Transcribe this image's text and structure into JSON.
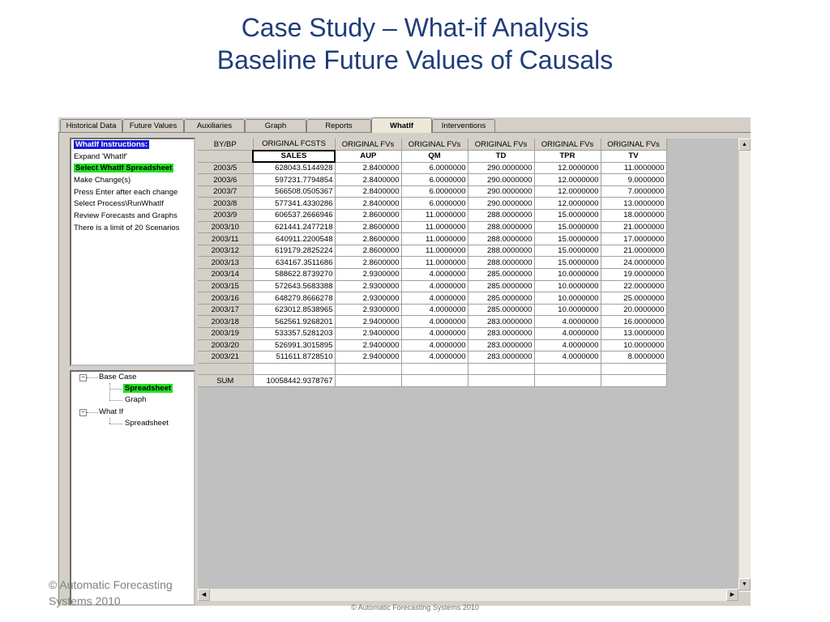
{
  "slide": {
    "title_line1": "Case Study – What-if Analysis",
    "title_line2": "Baseline Future Values of Causals",
    "footer_left": "© Automatic Forecasting Systems 2010",
    "footer_center": "© Automatic Forecasting Systems 2010"
  },
  "tabs": [
    {
      "label": "Historical Data"
    },
    {
      "label": "Future Values"
    },
    {
      "label": "Auxiliaries"
    },
    {
      "label": "Graph"
    },
    {
      "label": "Reports"
    },
    {
      "label": "WhatIf",
      "active": true
    },
    {
      "label": "Interventions"
    }
  ],
  "instructions": {
    "heading": "WhatIf Instructions:",
    "items": [
      "Expand 'WhatIf'",
      "Select WhatIf Spreadsheet",
      "Make Change(s)",
      "Press Enter after each change",
      "Select Process\\RunWhatIf",
      "Review Forecasts and Graphs",
      "There is a limit of 20 Scenarios"
    ]
  },
  "tree": {
    "base_case": "Base Case",
    "base_spreadsheet": "Spreadsheet",
    "base_graph": "Graph",
    "what_if": "What If",
    "whatif_spreadsheet": "Spreadsheet"
  },
  "grid": {
    "corner": "BY/BP",
    "header_row1": [
      "ORIGINAL FCSTS",
      "ORIGINAL FVs",
      "ORIGINAL FVs",
      "ORIGINAL FVs",
      "ORIGINAL FVs",
      "ORIGINAL FVs"
    ],
    "header_row2": [
      "SALES",
      "AUP",
      "QM",
      "TD",
      "TPR",
      "TV"
    ],
    "rows": [
      {
        "label": "2003/5",
        "values": [
          "628043.5144928",
          "2.8400000",
          "6.0000000",
          "290.0000000",
          "12.0000000",
          "11.0000000"
        ]
      },
      {
        "label": "2003/6",
        "values": [
          "597231.7794854",
          "2.8400000",
          "6.0000000",
          "290.0000000",
          "12.0000000",
          "9.0000000"
        ]
      },
      {
        "label": "2003/7",
        "values": [
          "566508.0505367",
          "2.8400000",
          "6.0000000",
          "290.0000000",
          "12.0000000",
          "7.0000000"
        ]
      },
      {
        "label": "2003/8",
        "values": [
          "577341.4330286",
          "2.8400000",
          "6.0000000",
          "290.0000000",
          "12.0000000",
          "13.0000000"
        ]
      },
      {
        "label": "2003/9",
        "values": [
          "606537.2666946",
          "2.8600000",
          "11.0000000",
          "288.0000000",
          "15.0000000",
          "18.0000000"
        ]
      },
      {
        "label": "2003/10",
        "values": [
          "621441.2477218",
          "2.8600000",
          "11.0000000",
          "288.0000000",
          "15.0000000",
          "21.0000000"
        ]
      },
      {
        "label": "2003/11",
        "values": [
          "640911.2200548",
          "2.8600000",
          "11.0000000",
          "288.0000000",
          "15.0000000",
          "17.0000000"
        ]
      },
      {
        "label": "2003/12",
        "values": [
          "619179.2825224",
          "2.8600000",
          "11.0000000",
          "288.0000000",
          "15.0000000",
          "21.0000000"
        ]
      },
      {
        "label": "2003/13",
        "values": [
          "634167.3511686",
          "2.8600000",
          "11.0000000",
          "288.0000000",
          "15.0000000",
          "24.0000000"
        ]
      },
      {
        "label": "2003/14",
        "values": [
          "588622.8739270",
          "2.9300000",
          "4.0000000",
          "285.0000000",
          "10.0000000",
          "19.0000000"
        ]
      },
      {
        "label": "2003/15",
        "values": [
          "572643.5683388",
          "2.9300000",
          "4.0000000",
          "285.0000000",
          "10.0000000",
          "22.0000000"
        ]
      },
      {
        "label": "2003/16",
        "values": [
          "648279.8666278",
          "2.9300000",
          "4.0000000",
          "285.0000000",
          "10.0000000",
          "25.0000000"
        ]
      },
      {
        "label": "2003/17",
        "values": [
          "623012.8538965",
          "2.9300000",
          "4.0000000",
          "285.0000000",
          "10.0000000",
          "20.0000000"
        ]
      },
      {
        "label": "2003/18",
        "values": [
          "562561.9268201",
          "2.9400000",
          "4.0000000",
          "283.0000000",
          "4.0000000",
          "16.0000000"
        ]
      },
      {
        "label": "2003/19",
        "values": [
          "533357.5281203",
          "2.9400000",
          "4.0000000",
          "283.0000000",
          "4.0000000",
          "13.0000000"
        ]
      },
      {
        "label": "2003/20",
        "values": [
          "526991.3015895",
          "2.9400000",
          "4.0000000",
          "283.0000000",
          "4.0000000",
          "10.0000000"
        ]
      },
      {
        "label": "2003/21",
        "values": [
          "511611.8728510",
          "2.9400000",
          "4.0000000",
          "283.0000000",
          "4.0000000",
          "8.0000000"
        ]
      }
    ],
    "sum_label": "SUM",
    "sum_value": "10058442.9378767"
  },
  "icons": {
    "scroll_up": "scroll-up-arrow-icon",
    "scroll_down": "scroll-down-arrow-icon",
    "scroll_left": "scroll-left-arrow-icon",
    "scroll_right": "scroll-right-arrow-icon",
    "expander": "tree-collapse-icon"
  },
  "colors": {
    "title": "#1f3d7a",
    "highlight_blue": "#1a1ad6",
    "highlight_green": "#22e022",
    "panel": "#d4d0c8",
    "grid_background": "#c0c0c0"
  }
}
